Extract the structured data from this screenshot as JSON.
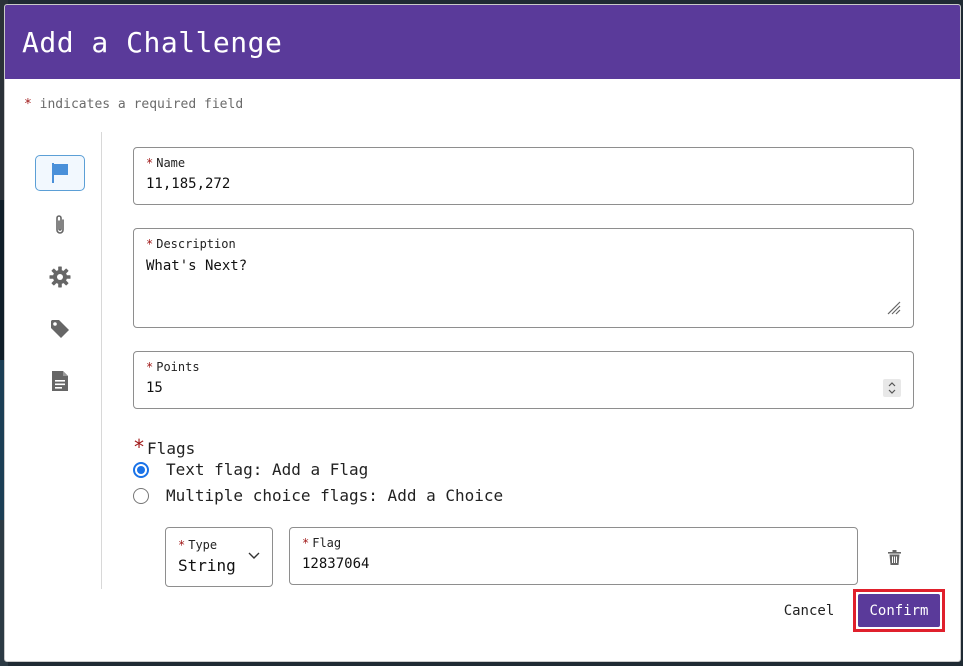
{
  "dialog": {
    "title": "Add a Challenge",
    "required_note": "indicates a required field",
    "required_marker": "*"
  },
  "sidebar": {
    "items": [
      {
        "icon": "flag-icon",
        "active": true
      },
      {
        "icon": "paperclip-icon",
        "active": false
      },
      {
        "icon": "gear-icon",
        "active": false
      },
      {
        "icon": "tag-icon",
        "active": false
      },
      {
        "icon": "document-icon",
        "active": false
      }
    ]
  },
  "form": {
    "name": {
      "label": "Name",
      "value": "11,185,272"
    },
    "description": {
      "label": "Description",
      "value": "What's Next?"
    },
    "points": {
      "label": "Points",
      "value": "15"
    },
    "flags": {
      "label": "Flags",
      "options": [
        {
          "label": "Text flag: Add a Flag",
          "checked": true
        },
        {
          "label": "Multiple choice flags: Add a Choice",
          "checked": false
        }
      ],
      "type": {
        "label": "Type",
        "value": "String"
      },
      "flag": {
        "label": "Flag",
        "value": "12837064"
      }
    }
  },
  "actions": {
    "cancel_label": "Cancel",
    "confirm_label": "Confirm"
  },
  "colors": {
    "header_bg": "#5a3a9a",
    "primary": "#5a3a9a",
    "required": "#a01818",
    "radio_checked": "#1a73e8",
    "highlight_border": "#e0202c",
    "active_nav_border": "#5b9fd6",
    "nav_flag_icon": "#4a90d9"
  }
}
